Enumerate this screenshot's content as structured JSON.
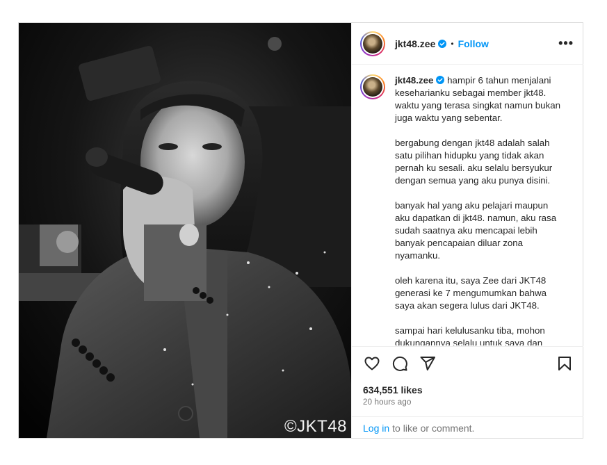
{
  "post": {
    "username": "jkt48.zee",
    "follow_label": "Follow",
    "separator": "•",
    "more_label": "•••",
    "watermark": "©JKT48",
    "caption": [
      "hampir 6 tahun menjalani keseharianku sebagai member jkt48. waktu yang terasa singkat namun bukan juga waktu yang sebentar.",
      "bergabung dengan jkt48 adalah salah satu pilihan hidupku yang tidak akan pernah ku sesali. aku selalu bersyukur dengan semua yang aku punya disini.",
      "banyak hal yang aku pelajari maupun aku dapatkan di jkt48. namun, aku rasa sudah saatnya aku mencapai lebih banyak pencapaian diluar zona nyamanku.",
      "oleh karena itu, saya Zee dari JKT48 generasi ke 7 mengumumkan bahwa saya akan segera lulus dari JKT48.",
      "sampai hari kelulusanku tiba, mohon dukungannya selalu untuk saya dan"
    ],
    "likes": "634,551 likes",
    "time": "20 hours ago",
    "login_label": "Log in",
    "comment_prompt": "to like or comment.",
    "colors": {
      "accent": "#0095f6",
      "verified": "#0095f6",
      "muted": "#737373"
    }
  }
}
